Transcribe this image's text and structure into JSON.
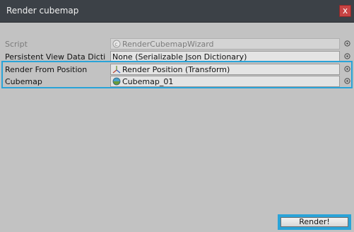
{
  "window": {
    "title": "Render cubemap",
    "close_glyph": "x"
  },
  "fields": [
    {
      "label": "Script",
      "value": "RenderCubemapWizard",
      "icon": "script-icon",
      "enabled": false
    },
    {
      "label": "Persistent View Data Dicti",
      "value": "None (Serializable Json Dictionary)",
      "icon": "",
      "enabled": true
    },
    {
      "label": "Render From Position",
      "value": "Render Position (Transform)",
      "icon": "transform-icon",
      "enabled": true
    },
    {
      "label": "Cubemap",
      "value": "Cubemap_01",
      "icon": "cubemap-icon",
      "enabled": true
    }
  ],
  "actions": {
    "render_label": "Render!"
  },
  "colors": {
    "highlight": "#2aa3d8",
    "titlebar": "#3c4147",
    "close": "#c74444",
    "panel": "#c2c2c2"
  }
}
